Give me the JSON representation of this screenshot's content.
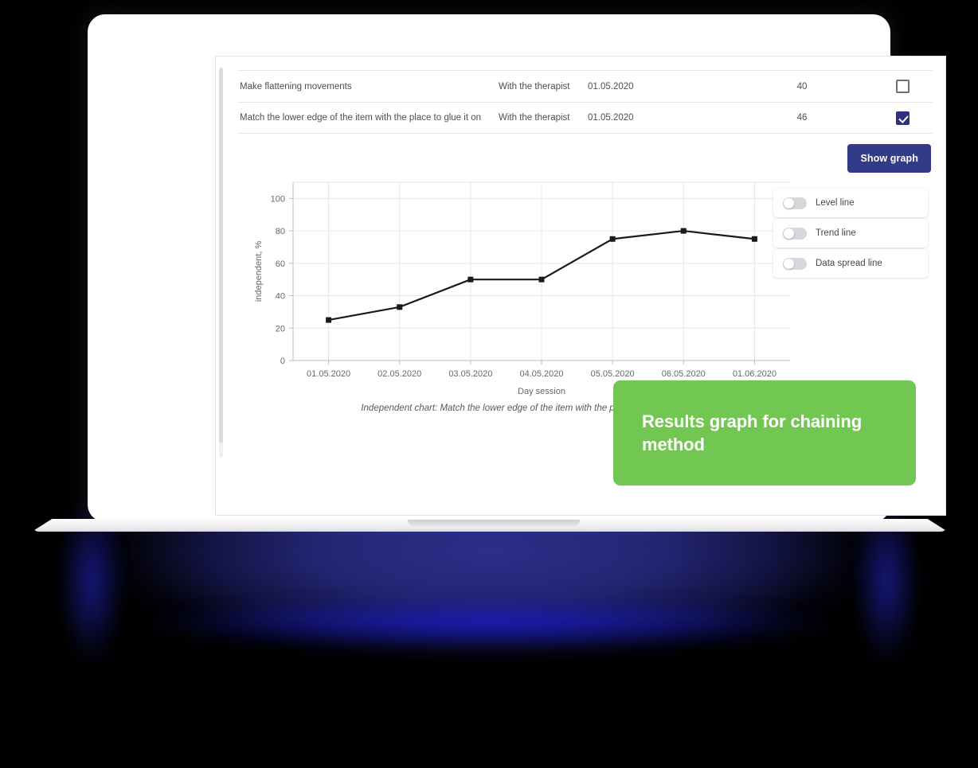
{
  "table": {
    "rows": [
      {
        "task": "Make flattening movements",
        "who": "With the therapist",
        "date": "01.05.2020",
        "score": "40",
        "checked": false
      },
      {
        "task": "Match the lower edge of the item with the place to glue it on",
        "who": "With the therapist",
        "date": "01.05.2020",
        "score": "46",
        "checked": true
      }
    ]
  },
  "actions": {
    "show_graph_label": "Show graph"
  },
  "toggles": [
    {
      "label": "Level line",
      "on": false
    },
    {
      "label": "Trend line",
      "on": false
    },
    {
      "label": "Data spread line",
      "on": false
    }
  ],
  "chart_caption": "Independent chart: Match the lower edge of the item with the place to glue it on.",
  "callout": {
    "text": "Results graph for chaining method",
    "color": "#72c752"
  },
  "colors": {
    "accent_navy": "#333a87",
    "checkbox_checked": "#2e3180",
    "callout_green": "#72c752",
    "line": "#1a1a1a",
    "grid": "#e6e6ea"
  },
  "chart_data": {
    "type": "line",
    "title": "",
    "xlabel": "Day session",
    "ylabel": "independent, %",
    "categories": [
      "01.05.2020",
      "02.05.2020",
      "03.05.2020",
      "04.05.2020",
      "05.05.2020",
      "06.05.2020",
      "01.06.2020"
    ],
    "values": [
      25,
      33,
      50,
      50,
      75,
      80,
      75
    ],
    "ylim": [
      0,
      110
    ],
    "yticks": [
      0,
      20,
      40,
      60,
      80,
      100
    ],
    "grid": true,
    "legend": "none",
    "marker": "square",
    "series": [
      {
        "name": "independent, %",
        "values": [
          25,
          33,
          50,
          50,
          75,
          80,
          75
        ]
      }
    ]
  }
}
